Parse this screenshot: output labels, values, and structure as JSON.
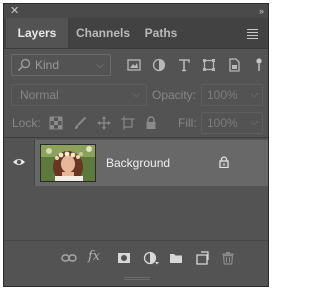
{
  "window": {
    "close_glyph": "✕",
    "collapse_glyph": "»"
  },
  "tabs": [
    {
      "label": "Layers",
      "active": true
    },
    {
      "label": "Channels",
      "active": false
    },
    {
      "label": "Paths",
      "active": false
    }
  ],
  "filter": {
    "kind_label": "Kind",
    "icons": [
      "image-filter-icon",
      "adjustment-filter-icon",
      "type-filter-icon",
      "shape-filter-icon",
      "smart-object-filter-icon"
    ]
  },
  "blend": {
    "mode": "Normal",
    "opacity_label": "Opacity:",
    "opacity_value": "100%"
  },
  "lock": {
    "label": "Lock:",
    "icons": [
      "lock-transparent-pixels-icon",
      "lock-image-pixels-icon",
      "lock-position-icon",
      "lock-artboard-icon",
      "lock-all-icon"
    ],
    "fill_label": "Fill:",
    "fill_value": "100%"
  },
  "layers": [
    {
      "name": "Background",
      "visible": true,
      "locked": true
    }
  ],
  "bottom_icons": [
    "link-layers-icon",
    "fx-icon",
    "layer-mask-icon",
    "adjustment-layer-icon",
    "new-group-icon",
    "new-layer-icon",
    "delete-layer-icon"
  ],
  "bottom_fx_label": "fx",
  "colors": {
    "panel": "#535353",
    "tab_bar": "#424242",
    "selected_layer": "#686868"
  }
}
